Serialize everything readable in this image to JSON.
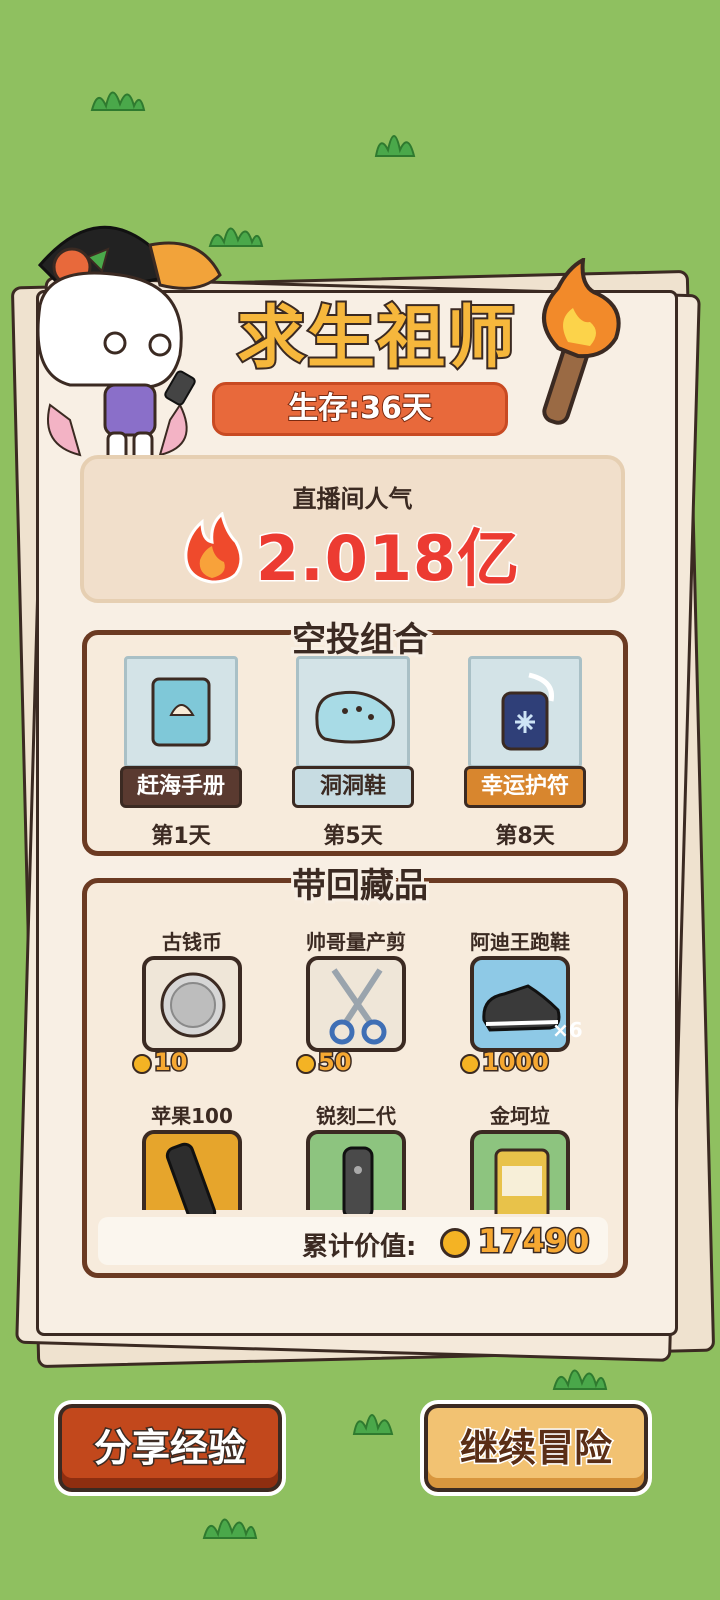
{
  "title": "求生祖师",
  "survival": {
    "label": "生存:36天"
  },
  "popularity": {
    "label": "直播间人气",
    "value": "2.018亿"
  },
  "airdrop": {
    "title": "空投组合",
    "items": [
      {
        "name": "赶海手册",
        "day": "第1天",
        "label_bg": "#5a3a30",
        "label_color": "#ffffff"
      },
      {
        "name": "洞洞鞋",
        "day": "第5天",
        "label_bg": "#c7dce2",
        "label_color": "#3b2a22"
      },
      {
        "name": "幸运护符",
        "day": "第8天",
        "label_bg": "#d8862e",
        "label_color": "#ffffff"
      }
    ]
  },
  "collection": {
    "title": "带回藏品",
    "items": [
      {
        "name": "古钱币",
        "price": "10",
        "bg": "#efe6d8"
      },
      {
        "name": "帅哥量产剪",
        "price": "50",
        "bg": "#efe6d8"
      },
      {
        "name": "阿迪王跑鞋",
        "price": "1000",
        "bg": "#8ec9e6",
        "badge": "×6"
      },
      {
        "name": "苹果100",
        "bg": "#e6a52c"
      },
      {
        "name": "锐刻二代",
        "bg": "#8dc47f"
      },
      {
        "name": "金坷垃",
        "bg": "#8dc47f"
      }
    ],
    "total_label": "累计价值:",
    "total_value": "17490"
  },
  "buttons": {
    "share": "分享经验",
    "continue": "继续冒险"
  },
  "colors": {
    "accent": "#e8693b",
    "brown": "#6b3a22",
    "grass": "#8fc060"
  }
}
